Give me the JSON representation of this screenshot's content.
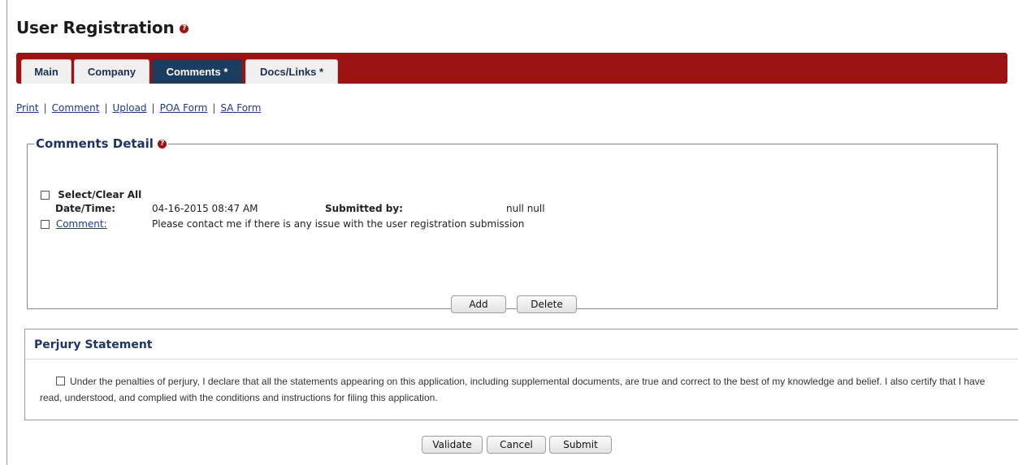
{
  "page": {
    "title": "User Registration"
  },
  "tabs": [
    {
      "label": "Main"
    },
    {
      "label": "Company"
    },
    {
      "label": "Comments *"
    },
    {
      "label": "Docs/Links *"
    }
  ],
  "links": [
    "Print",
    "Comment",
    "Upload",
    "POA Form",
    "SA Form"
  ],
  "comments_detail": {
    "title": "Comments Detail",
    "select_all_label": "Select/Clear All",
    "date_label": "Date/Time:",
    "date_value": "04-16-2015 08:47 AM",
    "submitted_label": "Submitted by:",
    "submitted_value": "null null",
    "comment_link": "Comment:",
    "comment_text": "Please contact me if there is any issue with the user registration submission",
    "add_label": "Add",
    "delete_label": "Delete"
  },
  "perjury": {
    "title": "Perjury Statement",
    "text": "Under the penalties of perjury, I declare that all the statements appearing on this application, including supplemental documents, are true and correct to the best of my knowledge and belief. I also certify that I have read, understood, and complied with the conditions and instructions for filing this application."
  },
  "actions": {
    "validate_label": "Validate",
    "cancel_label": "Cancel",
    "submit_label": "Submit"
  },
  "colors": {
    "tabbar_bg": "#9b1212",
    "active_tab_bg": "#1d3d5c",
    "heading_blue": "#1d3466",
    "link_blue": "#1a3a8f"
  }
}
